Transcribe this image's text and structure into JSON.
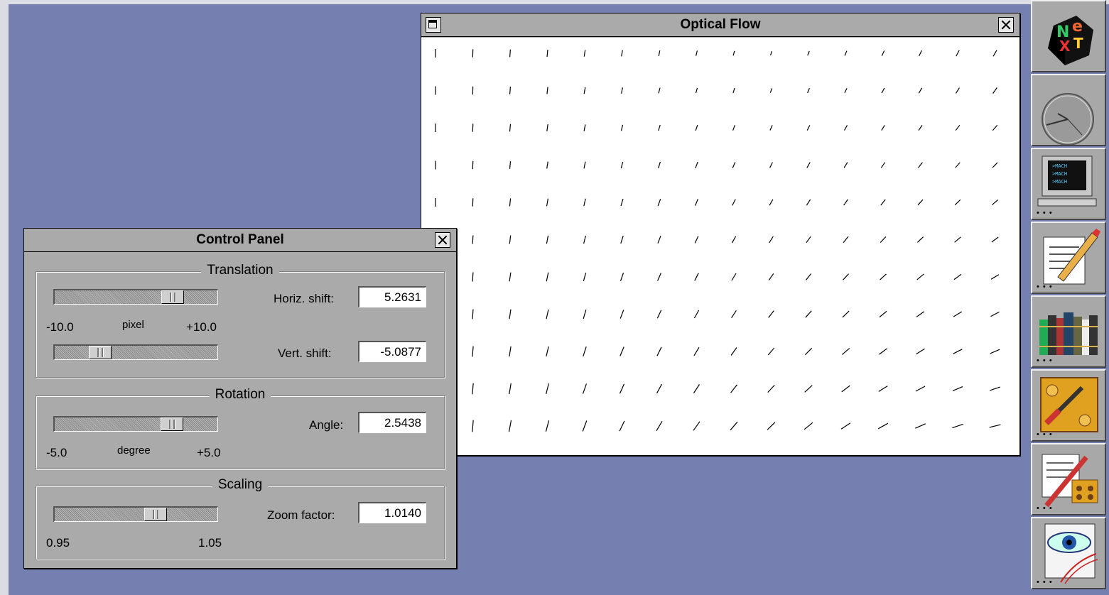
{
  "flow_window": {
    "title": "Optical Flow"
  },
  "control_panel": {
    "title": "Control Panel",
    "translation": {
      "group_title": "Translation",
      "horiz_label": "Horiz. shift:",
      "horiz_value": "5.2631",
      "horiz_fraction": 0.763,
      "min_label": "-10.0",
      "unit_label": "pixel",
      "max_label": "+10.0",
      "vert_label": "Vert. shift:",
      "vert_value": "-5.0877",
      "vert_fraction": 0.246
    },
    "rotation": {
      "group_title": "Rotation",
      "angle_label": "Angle:",
      "angle_value": "2.5438",
      "angle_fraction": 0.754,
      "min_label": "-5.0",
      "unit_label": "degree",
      "max_label": "+5.0"
    },
    "scaling": {
      "group_title": "Scaling",
      "zoom_label": "Zoom factor:",
      "zoom_value": "1.0140",
      "zoom_fraction": 0.64,
      "min_label": "0.95",
      "max_label": "1.05"
    }
  },
  "dock": {
    "icons": [
      "next-logo-icon",
      "clock-icon",
      "terminal-icon",
      "edit-icon",
      "library-icon",
      "preferences-icon",
      "project-builder-icon",
      "eye-viewer-icon"
    ]
  }
}
